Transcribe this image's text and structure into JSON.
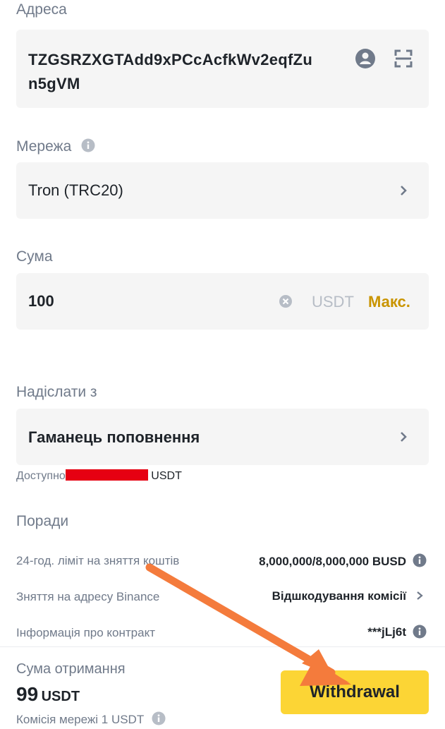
{
  "address": {
    "label": "Адреса",
    "value_line1": "TZGSRZXGTAdd9xPCcAcfkWv2eqfZu",
    "value_line2": "n5gVM"
  },
  "network": {
    "label": "Мережа",
    "value": "Tron (TRC20)"
  },
  "amount": {
    "label": "Сума",
    "value": "100",
    "currency": "USDT",
    "max_label": "Макс."
  },
  "send_from": {
    "label": "Надіслати з",
    "value": "Гаманець поповнення",
    "available_label": "Доступно",
    "available_currency": "USDT"
  },
  "tips": {
    "title": "Поради",
    "rows": [
      {
        "label": "24-год. ліміт на зняття коштів",
        "value": "8,000,000/8,000,000 BUSD"
      },
      {
        "label": "Зняття на адресу Binance",
        "value": "Відшкодування комісії"
      },
      {
        "label": "Інформація про контракт",
        "value": "***jLj6t"
      }
    ]
  },
  "receive": {
    "label": "Сума отримання",
    "amount": "99",
    "currency": "USDT",
    "fee_text": "Комісія мережі 1 USDT"
  },
  "withdraw_button": "Withdrawal",
  "colors": {
    "accent_yellow": "#fcd535",
    "max_gold": "#c99400",
    "redaction": "#e60012",
    "annotation_arrow": "#f47b3c"
  }
}
